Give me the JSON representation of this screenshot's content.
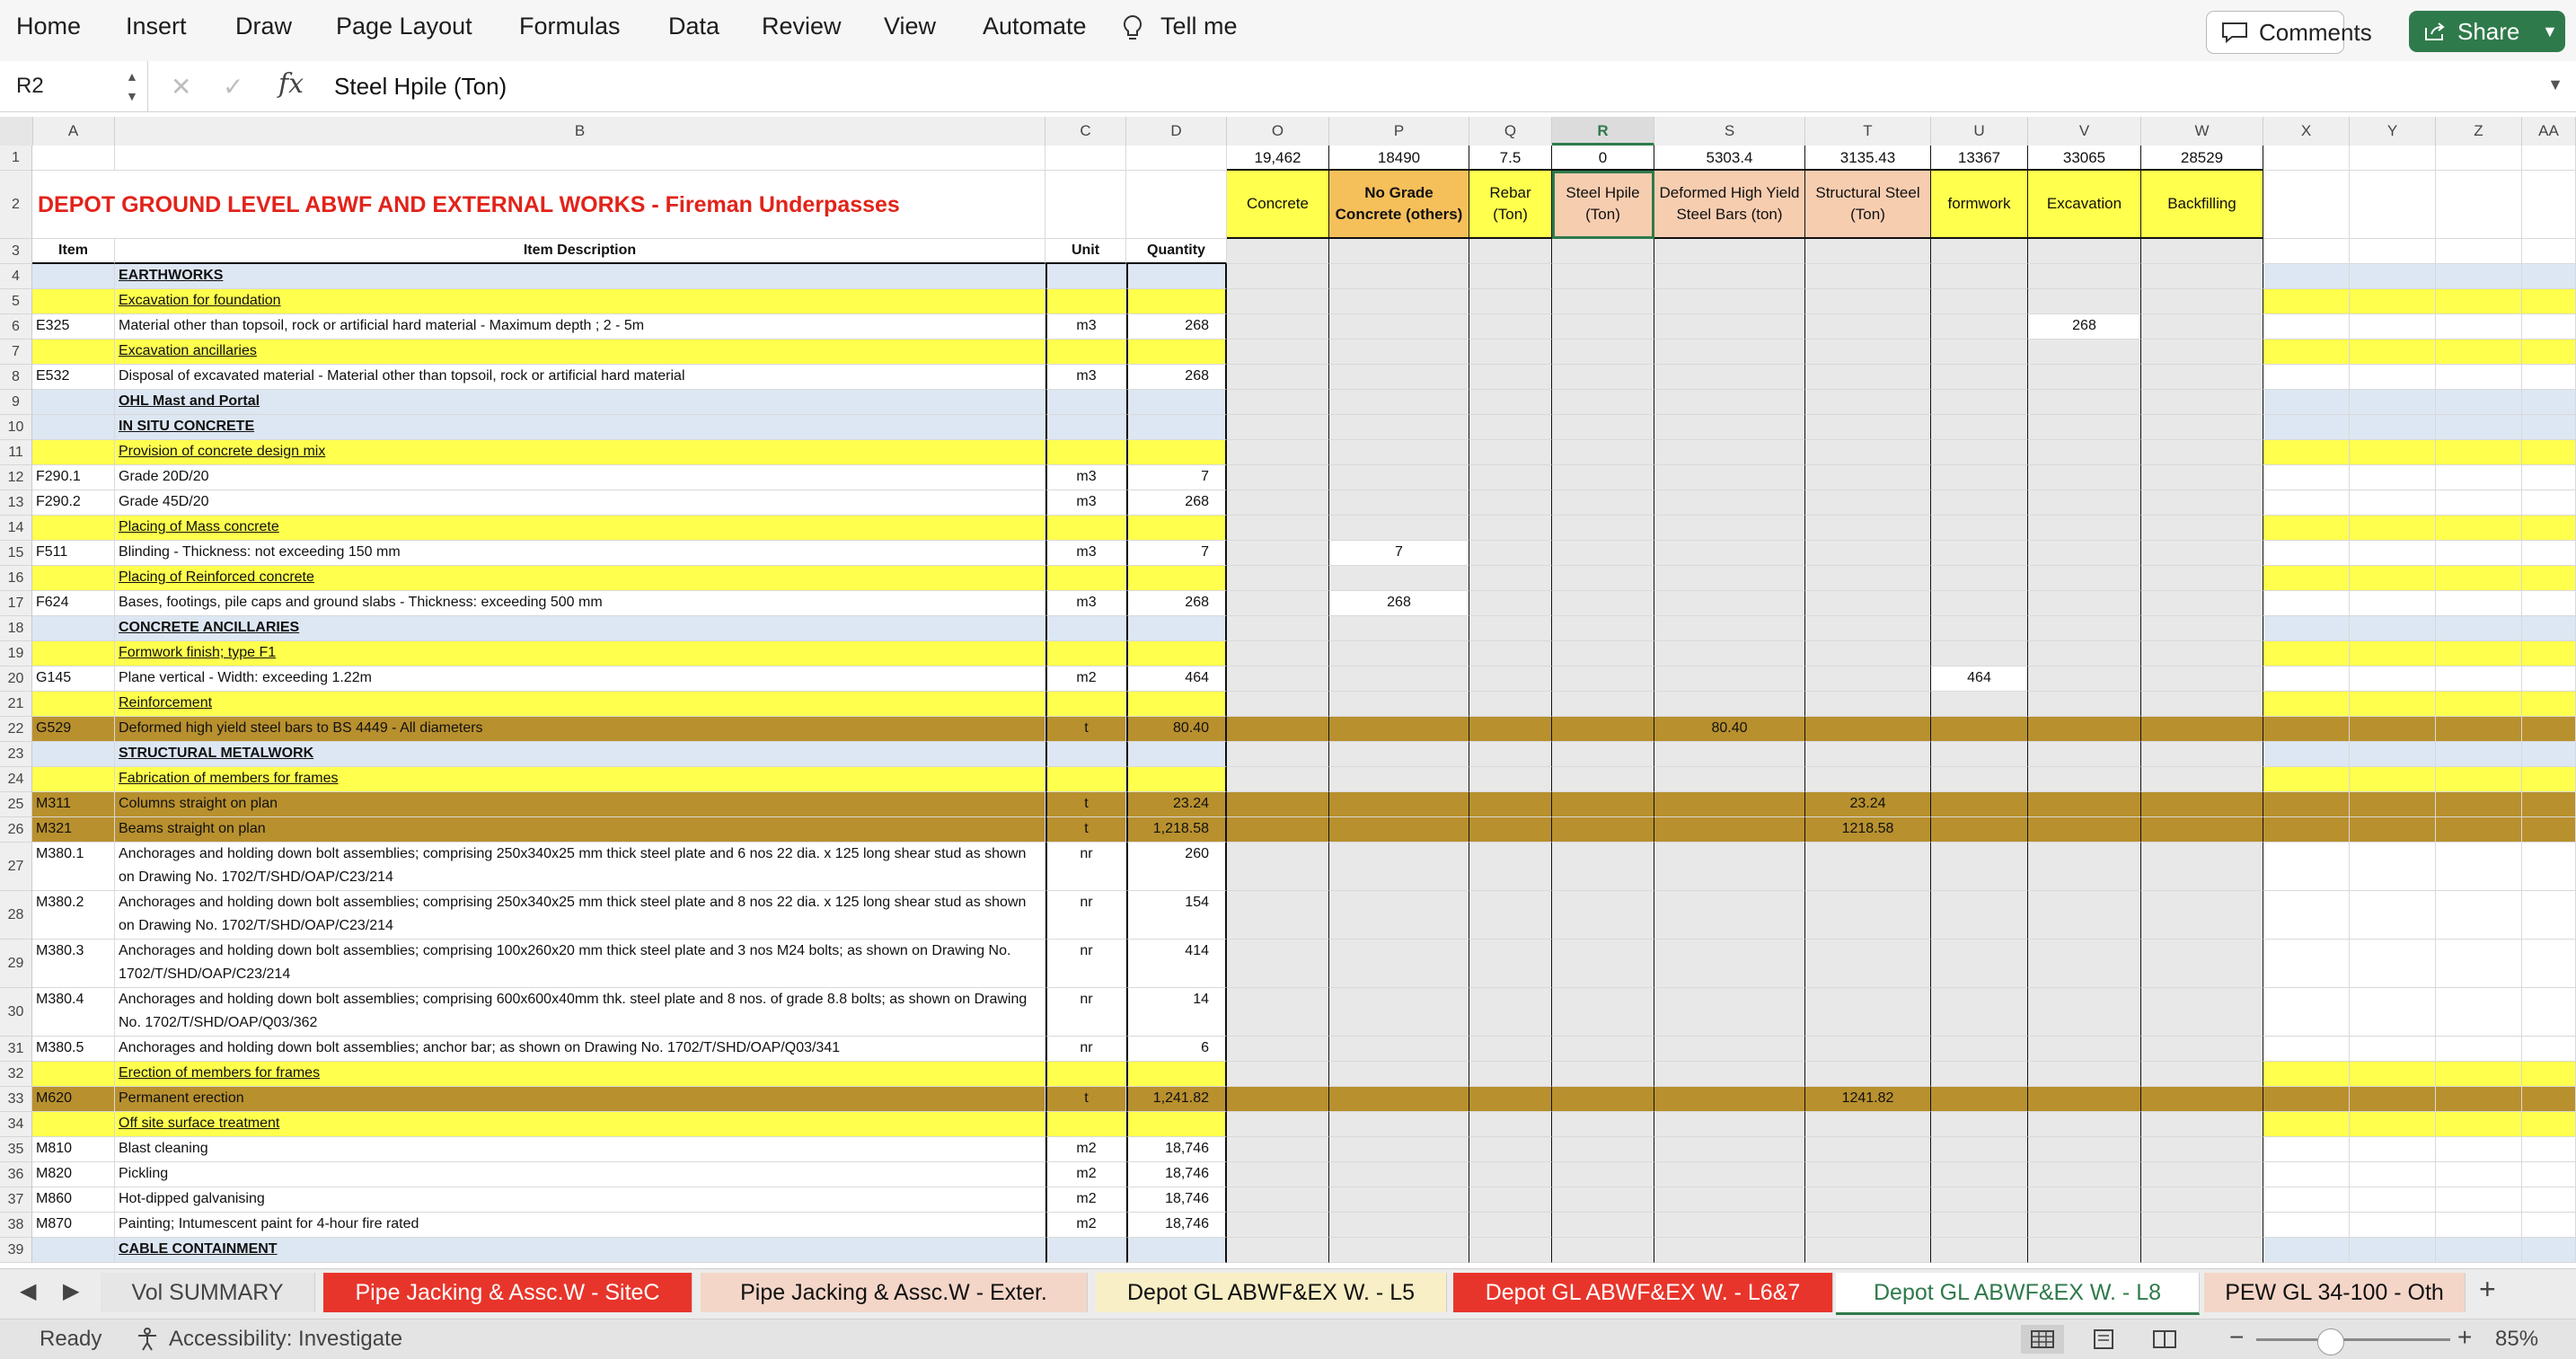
{
  "ribbon": {
    "tabs": [
      "Home",
      "Insert",
      "Draw",
      "Page Layout",
      "Formulas",
      "Data",
      "Review",
      "View",
      "Automate"
    ],
    "tell_me": "Tell me",
    "comments": "Comments",
    "share": "Share"
  },
  "formula_bar": {
    "cell_ref": "R2",
    "fx": "fx",
    "value": "Steel Hpile (Ton)"
  },
  "columns": [
    "A",
    "B",
    "C",
    "D",
    "O",
    "P",
    "Q",
    "R",
    "S",
    "T",
    "U",
    "V",
    "W",
    "X",
    "Y",
    "Z",
    "AA"
  ],
  "selected_column": "R",
  "title": "DEPOT GROUND LEVEL ABWF AND EXTERNAL WORKS - Fireman Underpasses",
  "table_headers": {
    "item": "Item",
    "description": "Item Description",
    "unit": "Unit",
    "quantity": "Quantity"
  },
  "summary": {
    "totals": [
      "19,462",
      "18490",
      "7.5",
      "0",
      "5303.4",
      "3135.43",
      "13367",
      "33065",
      "28529"
    ],
    "labels": [
      "Concrete",
      "No Grade Concrete (others)",
      "Rebar (Ton)",
      "Steel Hpile (Ton)",
      "Deformed High Yield Steel Bars (ton)",
      "Structural Steel (Ton)",
      "formwork",
      "Excavation",
      "Backfilling"
    ]
  },
  "rows": [
    {
      "n": "3"
    },
    {
      "n": "4",
      "b": "EARTHWORKS"
    },
    {
      "n": "5",
      "b": "Excavation for foundation"
    },
    {
      "n": "6",
      "a": "E325",
      "b": "Material other than topsoil, rock or artificial hard material -  Maximum depth ; 2 - 5m",
      "c": "m3",
      "d": "268",
      "v": "268"
    },
    {
      "n": "7",
      "b": "Excavation ancillaries"
    },
    {
      "n": "8",
      "a": "E532",
      "b": "Disposal of excavated material - Material other than topsoil, rock or artificial hard material",
      "c": "m3",
      "d": "268"
    },
    {
      "n": "9",
      "b": "OHL Mast and Portal"
    },
    {
      "n": "10",
      "b": "IN SITU CONCRETE"
    },
    {
      "n": "11",
      "b": "Provision of concrete design mix"
    },
    {
      "n": "12",
      "a": "F290.1",
      "b": "Grade 20D/20",
      "c": "m3",
      "d": "7"
    },
    {
      "n": "13",
      "a": "F290.2",
      "b": "Grade 45D/20",
      "c": "m3",
      "d": "268"
    },
    {
      "n": "14",
      "b": "Placing of Mass concrete"
    },
    {
      "n": "15",
      "a": "F511",
      "b": "Blinding - Thickness: not exceeding 150 mm",
      "c": "m3",
      "d": "7",
      "p": "7"
    },
    {
      "n": "16",
      "b": "Placing of Reinforced concrete"
    },
    {
      "n": "17",
      "a": "F624",
      "b": "Bases, footings, pile caps and ground slabs -  Thickness: exceeding 500 mm",
      "c": "m3",
      "d": "268",
      "p": "268"
    },
    {
      "n": "18",
      "b": "CONCRETE ANCILLARIES"
    },
    {
      "n": "19",
      "b": "Formwork finish; type F1"
    },
    {
      "n": "20",
      "a": "G145",
      "b": "Plane vertical -  Width: exceeding 1.22m",
      "c": "m2",
      "d": "464",
      "u": "464"
    },
    {
      "n": "21",
      "b": "Reinforcement"
    },
    {
      "n": "22",
      "a": "G529",
      "b": "Deformed high yield steel bars to BS 4449 -  All diameters",
      "c": "t",
      "d": "80.40",
      "s": "80.40"
    },
    {
      "n": "23",
      "b": "STRUCTURAL METALWORK"
    },
    {
      "n": "24",
      "b": "Fabrication of members for frames"
    },
    {
      "n": "25",
      "a": "M311",
      "b": "Columns straight on plan",
      "c": "t",
      "d": "23.24",
      "t": "23.24"
    },
    {
      "n": "26",
      "a": "M321",
      "b": "Beams straight on plan",
      "c": "t",
      "d": "1,218.58",
      "t": "1218.58"
    },
    {
      "n": "27",
      "a": "M380.1",
      "b": "Anchorages and holding down bolt assemblies; comprising 250x340x25 mm thick steel plate and 6 nos 22 dia. x 125 long shear stud as shown on Drawing No. 1702/T/SHD/OAP/C23/214",
      "c": "nr",
      "d": "260"
    },
    {
      "n": "28",
      "a": "M380.2",
      "b": "Anchorages and holding down bolt assemblies; comprising 250x340x25 mm thick steel plate and 8 nos 22 dia. x 125 long shear stud as shown on Drawing No. 1702/T/SHD/OAP/C23/214",
      "c": "nr",
      "d": "154"
    },
    {
      "n": "29",
      "a": "M380.3",
      "b": "Anchorages and holding down bolt assemblies; comprising 100x260x20 mm thick steel plate and 3 nos M24 bolts; as shown on Drawing No. 1702/T/SHD/OAP/C23/214",
      "c": "nr",
      "d": "414"
    },
    {
      "n": "30",
      "a": "M380.4",
      "b": "Anchorages and holding down bolt assemblies; comprising 600x600x40mm thk. steel plate and 8 nos. of grade 8.8 bolts; as shown on Drawing No. 1702/T/SHD/OAP/Q03/362",
      "c": "nr",
      "d": "14"
    },
    {
      "n": "31",
      "a": "M380.5",
      "b": "Anchorages and holding down bolt assemblies; anchor bar; as shown on Drawing No. 1702/T/SHD/OAP/Q03/341",
      "c": "nr",
      "d": "6"
    },
    {
      "n": "32",
      "b": "Erection of members for frames"
    },
    {
      "n": "33",
      "a": "M620",
      "b": "Permanent erection",
      "c": "t",
      "d": "1,241.82",
      "t": "1241.82"
    },
    {
      "n": "34",
      "b": "Off site surface treatment"
    },
    {
      "n": "35",
      "a": "M810",
      "b": "Blast cleaning",
      "c": "m2",
      "d": "18,746"
    },
    {
      "n": "36",
      "a": "M820",
      "b": "Pickling",
      "c": "m2",
      "d": "18,746"
    },
    {
      "n": "37",
      "a": "M860",
      "b": "Hot-dipped galvanising",
      "c": "m2",
      "d": "18,746"
    },
    {
      "n": "38",
      "a": "M870",
      "b": "Painting; Intumescent paint for 4-hour fire rated",
      "c": "m2",
      "d": "18,746"
    },
    {
      "n": "39",
      "b": "CABLE CONTAINMENT"
    }
  ],
  "sheet_tabs": [
    {
      "label": "Vol SUMMARY"
    },
    {
      "label": "Pipe Jacking & Assc.W - SiteC"
    },
    {
      "label": "Pipe Jacking & Assc.W - Exter."
    },
    {
      "label": "Depot GL ABWF&EX W. - L5"
    },
    {
      "label": "Depot GL ABWF&EX W. - L6&7"
    },
    {
      "label": "Depot GL ABWF&EX W. - L8"
    },
    {
      "label": "PEW GL 34-100 - Oth"
    }
  ],
  "status": {
    "ready": "Ready",
    "accessibility": "Accessibility: Investigate",
    "zoom": "85%"
  },
  "colors": {
    "accent": "#2f7a4b",
    "yellow": "#ffff4d",
    "gold": "#b8902e",
    "light_blue": "#dde7f3",
    "orange": "#f5c05a",
    "peach": "#f7cdb0",
    "red_tab": "#e8352b"
  }
}
